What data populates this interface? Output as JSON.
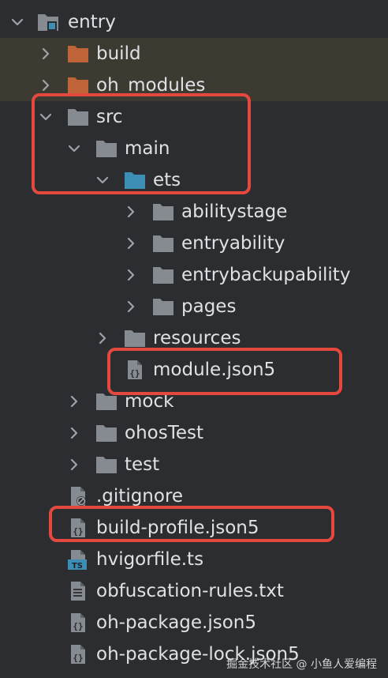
{
  "tree": {
    "items": [
      {
        "label": "entry",
        "depth": 0,
        "icon": "module-folder-icon",
        "expanded": true
      },
      {
        "label": "build",
        "depth": 1,
        "icon": "excluded-folder-icon",
        "expanded": false
      },
      {
        "label": "oh_modules",
        "depth": 1,
        "icon": "excluded-folder-icon",
        "expanded": false
      },
      {
        "label": "src",
        "depth": 1,
        "icon": "folder-icon",
        "expanded": true
      },
      {
        "label": "main",
        "depth": 2,
        "icon": "folder-icon",
        "expanded": true
      },
      {
        "label": "ets",
        "depth": 3,
        "icon": "source-folder-icon",
        "expanded": true
      },
      {
        "label": "abilitystage",
        "depth": 4,
        "icon": "folder-icon",
        "expanded": false
      },
      {
        "label": "entryability",
        "depth": 4,
        "icon": "folder-icon",
        "expanded": false
      },
      {
        "label": "entrybackupability",
        "depth": 4,
        "icon": "folder-icon",
        "expanded": false
      },
      {
        "label": "pages",
        "depth": 4,
        "icon": "folder-icon",
        "expanded": false
      },
      {
        "label": "resources",
        "depth": 3,
        "icon": "folder-icon",
        "expanded": false
      },
      {
        "label": "module.json5",
        "depth": 3,
        "icon": "json5-file-icon"
      },
      {
        "label": "mock",
        "depth": 2,
        "icon": "folder-icon",
        "expanded": false
      },
      {
        "label": "ohosTest",
        "depth": 2,
        "icon": "folder-icon",
        "expanded": false
      },
      {
        "label": "test",
        "depth": 2,
        "icon": "folder-icon",
        "expanded": false
      },
      {
        "label": ".gitignore",
        "depth": 1,
        "icon": "ignore-file-icon"
      },
      {
        "label": "build-profile.json5",
        "depth": 1,
        "icon": "json5-file-icon"
      },
      {
        "label": "hvigorfile.ts",
        "depth": 1,
        "icon": "typescript-file-icon"
      },
      {
        "label": "obfuscation-rules.txt",
        "depth": 1,
        "icon": "text-file-icon"
      },
      {
        "label": "oh-package.json5",
        "depth": 1,
        "icon": "json5-file-icon"
      },
      {
        "label": "oh-package-lock.json5",
        "depth": 1,
        "icon": "json5-file-icon"
      }
    ]
  },
  "colors": {
    "background": "#2b2d30",
    "text": "#dfe1e5",
    "folder": "#868a91",
    "excluded_folder": "#c0653a",
    "source_folder": "#3d8eb5",
    "highlight": "#e5483f"
  },
  "ts_badge": "TS",
  "watermark": "掘金技术社区 @ 小鱼人爱编程"
}
